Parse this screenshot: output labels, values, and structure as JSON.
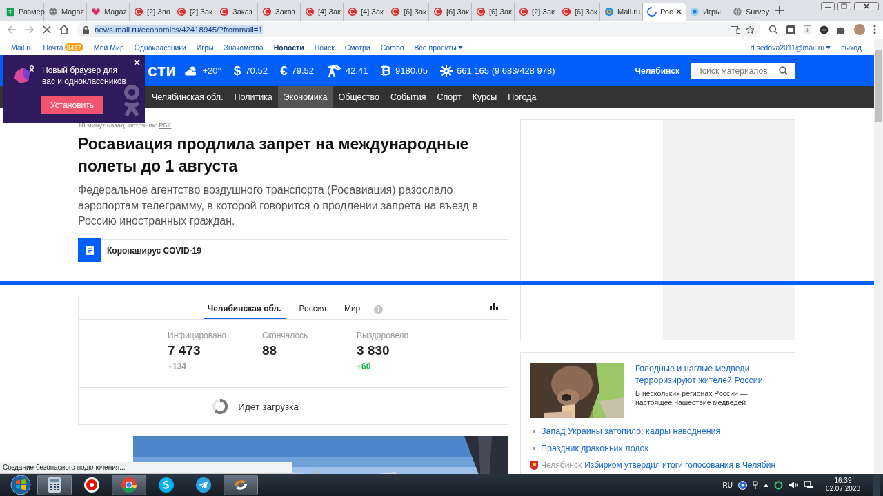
{
  "browser": {
    "tabs": [
      {
        "title": "Размер",
        "kind": "sheets",
        "selected": false
      },
      {
        "title": "Magaz",
        "kind": "globe",
        "selected": false
      },
      {
        "title": "Magaz",
        "kind": "heart",
        "selected": false
      },
      {
        "title": "[2] Зво",
        "kind": "crm",
        "selected": false
      },
      {
        "title": "[2] Зак",
        "kind": "crm",
        "selected": false
      },
      {
        "title": "Заказ",
        "kind": "crm",
        "selected": false
      },
      {
        "title": "Заказ",
        "kind": "crm",
        "selected": false
      },
      {
        "title": "[4] Зак",
        "kind": "crm",
        "selected": false
      },
      {
        "title": "[4] Зак",
        "kind": "crm",
        "selected": false
      },
      {
        "title": "[6] Зак",
        "kind": "crm",
        "selected": false
      },
      {
        "title": "[6] Зак",
        "kind": "crm",
        "selected": false
      },
      {
        "title": "[6] Зак",
        "kind": "crm",
        "selected": false
      },
      {
        "title": "[2] Зак",
        "kind": "crm",
        "selected": false
      },
      {
        "title": "[6] Зак",
        "kind": "crm",
        "selected": false
      },
      {
        "title": "Mail.ru",
        "kind": "mail",
        "selected": false
      },
      {
        "title": "Рос",
        "kind": "loading",
        "selected": true
      },
      {
        "title": "Игры",
        "kind": "game",
        "selected": false
      },
      {
        "title": "Survey",
        "kind": "globe",
        "selected": false
      }
    ],
    "url": "news.mail.ru/economics/42418945/?frommail=1"
  },
  "portal_bar": {
    "links": [
      {
        "label": "Mail.ru",
        "selected": false
      },
      {
        "label": "Почта",
        "badge": "8467",
        "selected": false
      },
      {
        "label": "Мой Мир",
        "selected": false
      },
      {
        "label": "Одноклассники",
        "selected": false
      },
      {
        "label": "Игры",
        "selected": false
      },
      {
        "label": "Знакомства",
        "selected": false
      },
      {
        "label": "Новости",
        "selected": true
      },
      {
        "label": "Поиск",
        "selected": false
      },
      {
        "label": "Смотри",
        "selected": false
      },
      {
        "label": "Combo",
        "selected": false
      },
      {
        "label": "Все проекты",
        "dropdown": true,
        "selected": false
      }
    ],
    "user": "d.sedova2011@mail.ru",
    "logout": "выход"
  },
  "header": {
    "logo": "сти",
    "indicators": [
      {
        "kind": "weather",
        "value": "+20°"
      },
      {
        "kind": "currency",
        "symbol": "$",
        "value": "70.52"
      },
      {
        "kind": "currency",
        "symbol": "€",
        "value": "79.52"
      },
      {
        "kind": "oil",
        "value": "42.41"
      },
      {
        "kind": "currency",
        "symbol": "₿",
        "value": "9180.05"
      },
      {
        "kind": "virus",
        "value": "661 165 (9 683/428 978)"
      }
    ],
    "city": "Челябинск",
    "search": {
      "placeholder": "Поиск материалов"
    }
  },
  "nav": [
    {
      "label": "Челябинская обл.",
      "selected": false
    },
    {
      "label": "Политика",
      "selected": false
    },
    {
      "label": "Экономика",
      "selected": true
    },
    {
      "label": "Общество",
      "selected": false
    },
    {
      "label": "События",
      "selected": false
    },
    {
      "label": "Спорт",
      "selected": false
    },
    {
      "label": "Курсы",
      "selected": false
    },
    {
      "label": "Погода",
      "selected": false
    }
  ],
  "popup": {
    "text": "Новый браузер для вас и одноклассников",
    "button": "Установить"
  },
  "article": {
    "meta": "18 минут назад, источник:",
    "source": "РБК",
    "title": "Росавиация продлила запрет на международные полеты до 1 августа",
    "lead": "Федеральное агентство воздушного транспорта (Росавиация) разослало аэропортам телеграмму, в которой говорится о продлении запрета на въезд в Россию иностранных граждан.",
    "tag": "Коронавирус COVID-19"
  },
  "covid": {
    "tabs": [
      {
        "label": "Челябинская обл.",
        "selected": true
      },
      {
        "label": "Россия",
        "selected": false
      },
      {
        "label": "Мир",
        "selected": false
      }
    ],
    "stats": [
      {
        "label": "Инфицировано",
        "value": "7 473",
        "delta": "+134",
        "color": "#999999"
      },
      {
        "label": "Скончалось",
        "value": "88"
      },
      {
        "label": "Выздоровело",
        "value": "3 830",
        "delta": "+60",
        "color": "#1db54a"
      }
    ],
    "loading": "Идёт загрузка"
  },
  "sidebar_card": {
    "headline": "Голодные и наглые медведи терроризируют жителей России",
    "summary": "В нескольких регионах России — настоящее нашествие медведей",
    "links": [
      "Запад Украины затопило: кадры наводнения",
      "Праздник драконьих лодок"
    ],
    "regional": {
      "city": "Челябинск",
      "headline": "Избирком утвердил итоги голосования в Челябин"
    }
  },
  "status_bubble": "Создание безопасного подключения...",
  "taskbar": {
    "apps": [
      {
        "kind": "calculator",
        "running": true
      },
      {
        "kind": "yandex",
        "running": false
      },
      {
        "kind": "chrome",
        "running": true
      },
      {
        "kind": "skype",
        "running": false
      },
      {
        "kind": "telegram",
        "running": false
      },
      {
        "kind": "app",
        "running": true
      }
    ],
    "language": "RU",
    "time": "16:39",
    "date": "02.07.2020"
  }
}
